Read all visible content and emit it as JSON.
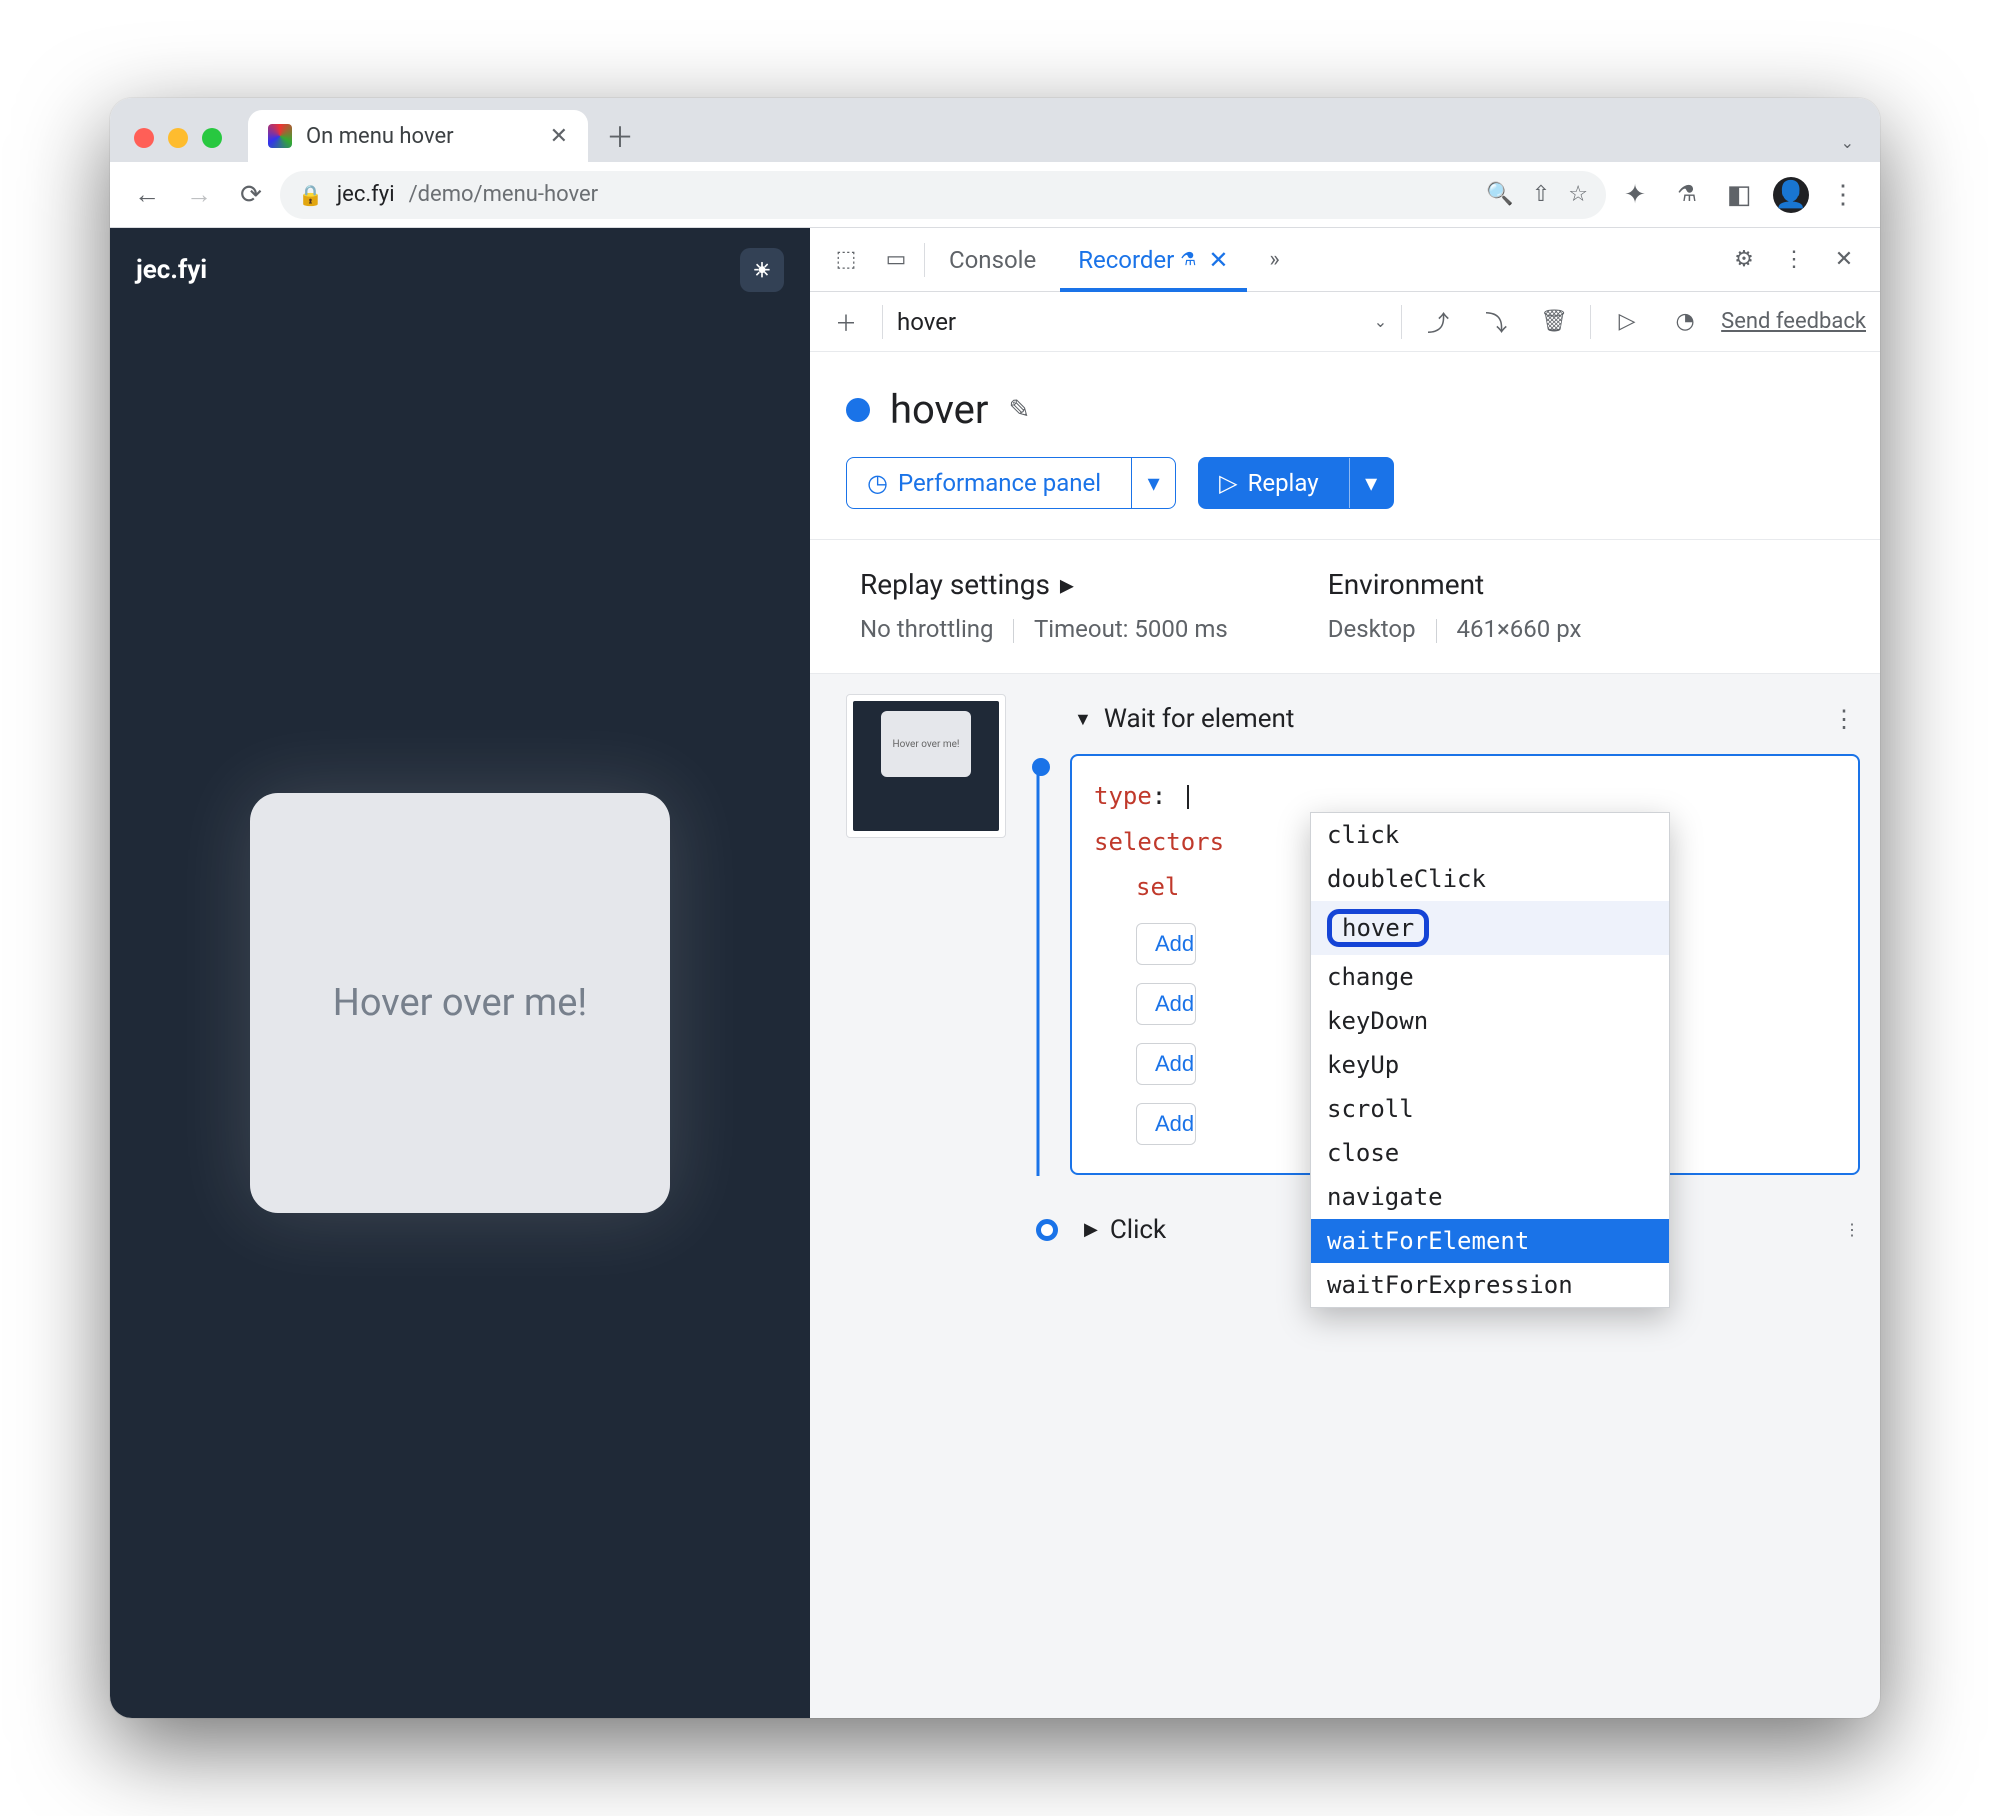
{
  "browser": {
    "tab_title": "On menu hover",
    "url_host": "jec.fyi",
    "url_path": "/demo/menu-hover"
  },
  "page": {
    "site_title": "jec.fyi",
    "card_text": "Hover over me!"
  },
  "devtools": {
    "tabs": {
      "console": "Console",
      "recorder": "Recorder"
    },
    "recording_name": "hover",
    "feedback": "Send feedback",
    "title": "hover",
    "perf_btn": "Performance panel",
    "replay_btn": "Replay",
    "settings": {
      "replay_heading": "Replay settings",
      "throttling": "No throttling",
      "timeout": "Timeout: 5000 ms",
      "env_heading": "Environment",
      "env_device": "Desktop",
      "env_size": "461×660 px"
    },
    "step": {
      "title": "Wait for element",
      "thumb_text": "Hover over me!",
      "kv_type_key": "type",
      "kv_selectors_key": "selectors",
      "kv_sel_prefix": "sel",
      "add_labels": [
        "Add",
        "Add",
        "Add",
        "Add"
      ]
    },
    "dropdown_options": [
      "click",
      "doubleClick",
      "hover",
      "change",
      "keyDown",
      "keyUp",
      "scroll",
      "close",
      "navigate",
      "waitForElement",
      "waitForExpression"
    ],
    "dropdown_highlight": "hover",
    "dropdown_selected": "waitForElement",
    "step2_title": "Click"
  }
}
